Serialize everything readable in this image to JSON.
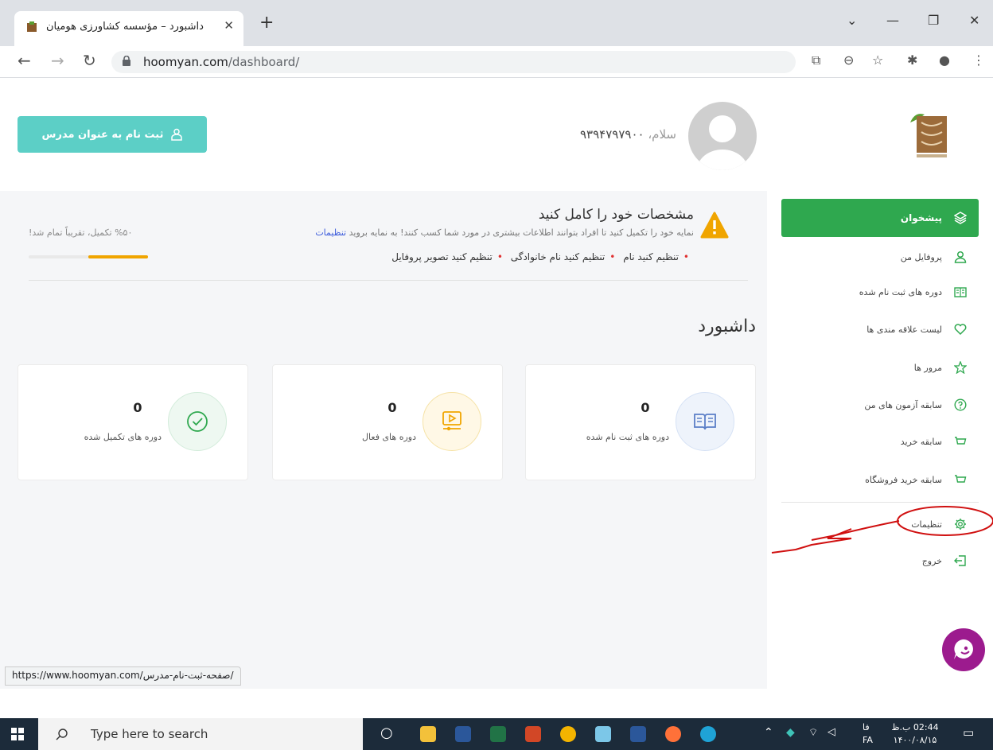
{
  "browser": {
    "tab_title": "داشبورد – مؤسسه کشاورزی هومیان",
    "url_host": "hoomyan.com",
    "url_path": "/dashboard/"
  },
  "header": {
    "teacher_button": "ثبت نام به عنوان مدرس",
    "greeting_hello": "سلام،",
    "greeting_name": "۹۳۹۴۷۹۷۹۰۰"
  },
  "alert": {
    "title": "مشخصات خود را کامل کنید",
    "desc": "نمایه خود را تکمیل کنید تا افراد بتوانند اطلاعات بیشتری در مورد شما کسب کنند! به نمایه بروید",
    "desc_link": "تنظیمات",
    "items": [
      "تنظیم کنید نام",
      "تنظیم کنید نام خانوادگی",
      "تنظیم کنید تصویر پروفایل"
    ],
    "progress_label": "%۵۰ تکمیل، تقریباً تمام شد!",
    "progress_percent": 50
  },
  "dashboard": {
    "title": "داشبورد",
    "cards": [
      {
        "value": "0",
        "label": "دوره های ثبت نام شده",
        "icon": "book-icon",
        "bg": "#eef3fb",
        "border": "#d6e2f5",
        "color": "#5b7fc7"
      },
      {
        "value": "0",
        "label": "دوره های فعال",
        "icon": "video-icon",
        "bg": "#fff8e6",
        "border": "#f6e3a8",
        "color": "#f0a500"
      },
      {
        "value": "0",
        "label": "دوره های تکمیل شده",
        "icon": "check-circle-icon",
        "bg": "#eef8f1",
        "border": "#d3ecdb",
        "color": "#2fa84f"
      }
    ]
  },
  "sidebar": {
    "active": "پیشخوان",
    "items": [
      {
        "label": "پروفایل من",
        "icon": "user-icon"
      },
      {
        "label": "دوره های ثبت نام شده",
        "icon": "book-icon"
      },
      {
        "label": "لیست علاقه مندی ها",
        "icon": "heart-icon"
      },
      {
        "label": "مرور ها",
        "icon": "star-icon"
      },
      {
        "label": "سابقه آزمون های من",
        "icon": "question-icon"
      },
      {
        "label": "سابقه خرید",
        "icon": "cart-icon"
      },
      {
        "label": "سابقه خرید فروشگاه",
        "icon": "cart-icon"
      },
      {
        "label": "تنظیمات",
        "icon": "gear-icon"
      },
      {
        "label": "خروج",
        "icon": "logout-icon"
      }
    ],
    "accent": "#2fa84f"
  },
  "status_url": "https://www.hoomyan.com/صفحه-ثبت-نام-مدرس/",
  "taskbar": {
    "search_placeholder": "Type here to search",
    "time": "02:44 ب.ظ",
    "date": "۱۴۰۰/۰۸/۱۵",
    "lang_top": "فا",
    "lang_bottom": "FA"
  }
}
